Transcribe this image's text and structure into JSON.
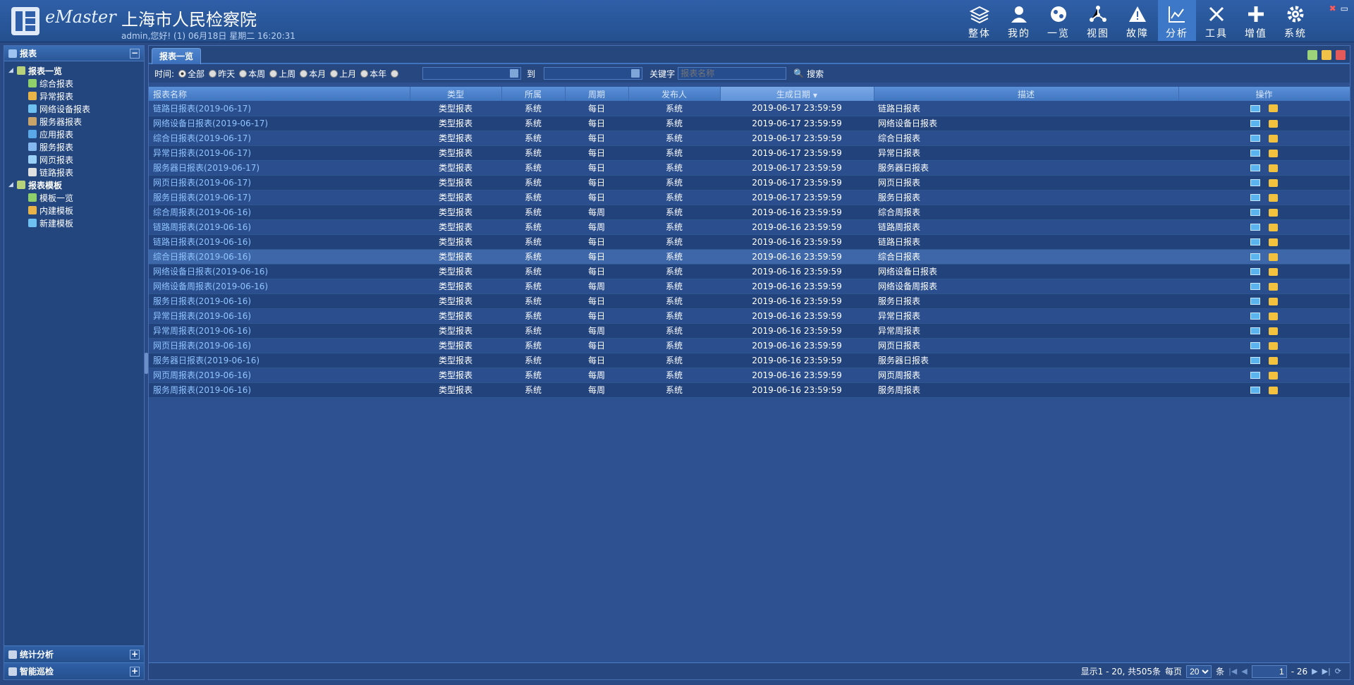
{
  "header": {
    "brand": "eMaster",
    "org": "上海市人民检察院",
    "userline": "admin,您好! (1) 06月18日 星期二 16:20:31",
    "nav": [
      {
        "label": "整体",
        "icon": "layers-icon"
      },
      {
        "label": "我的",
        "icon": "user-icon"
      },
      {
        "label": "一览",
        "icon": "globe-icon"
      },
      {
        "label": "视图",
        "icon": "network-icon"
      },
      {
        "label": "故障",
        "icon": "warning-icon"
      },
      {
        "label": "分析",
        "icon": "chart-icon",
        "active": true
      },
      {
        "label": "工具",
        "icon": "tools-icon"
      },
      {
        "label": "增值",
        "icon": "plus-icon"
      },
      {
        "label": "系统",
        "icon": "gear-icon"
      }
    ]
  },
  "sidebar": {
    "title": "报表",
    "tree": {
      "group1": "报表一览",
      "items1": [
        "综合报表",
        "异常报表",
        "网络设备报表",
        "服务器报表",
        "应用报表",
        "服务报表",
        "网页报表",
        "链路报表"
      ],
      "group2": "报表模板",
      "items2": [
        "模板一览",
        "内建模板",
        "新建模板"
      ]
    },
    "accordion": [
      "统计分析",
      "智能巡检"
    ]
  },
  "tab": {
    "label": "报表一览"
  },
  "filter": {
    "time_label": "时间:",
    "options": [
      "全部",
      "昨天",
      "本周",
      "上周",
      "本月",
      "上月",
      "本年"
    ],
    "selected": "全部",
    "to_label": "到",
    "keyword_label": "关键字",
    "keyword_placeholder": "报表名称",
    "search_label": "搜索"
  },
  "table": {
    "columns": [
      "报表名称",
      "类型",
      "所属",
      "周期",
      "发布人",
      "生成日期",
      "描述",
      "操作"
    ],
    "sorted_column": "生成日期",
    "rows": [
      [
        "链路日报表(2019-06-17)",
        "类型报表",
        "系统",
        "每日",
        "系统",
        "2019-06-17 23:59:59",
        "链路日报表"
      ],
      [
        "网络设备日报表(2019-06-17)",
        "类型报表",
        "系统",
        "每日",
        "系统",
        "2019-06-17 23:59:59",
        "网络设备日报表"
      ],
      [
        "综合日报表(2019-06-17)",
        "类型报表",
        "系统",
        "每日",
        "系统",
        "2019-06-17 23:59:59",
        "综合日报表"
      ],
      [
        "异常日报表(2019-06-17)",
        "类型报表",
        "系统",
        "每日",
        "系统",
        "2019-06-17 23:59:59",
        "异常日报表"
      ],
      [
        "服务器日报表(2019-06-17)",
        "类型报表",
        "系统",
        "每日",
        "系统",
        "2019-06-17 23:59:59",
        "服务器日报表"
      ],
      [
        "网页日报表(2019-06-17)",
        "类型报表",
        "系统",
        "每日",
        "系统",
        "2019-06-17 23:59:59",
        "网页日报表"
      ],
      [
        "服务日报表(2019-06-17)",
        "类型报表",
        "系统",
        "每日",
        "系统",
        "2019-06-17 23:59:59",
        "服务日报表"
      ],
      [
        "综合周报表(2019-06-16)",
        "类型报表",
        "系统",
        "每周",
        "系统",
        "2019-06-16 23:59:59",
        "综合周报表"
      ],
      [
        "链路周报表(2019-06-16)",
        "类型报表",
        "系统",
        "每周",
        "系统",
        "2019-06-16 23:59:59",
        "链路周报表"
      ],
      [
        "链路日报表(2019-06-16)",
        "类型报表",
        "系统",
        "每日",
        "系统",
        "2019-06-16 23:59:59",
        "链路日报表"
      ],
      [
        "综合日报表(2019-06-16)",
        "类型报表",
        "系统",
        "每日",
        "系统",
        "2019-06-16 23:59:59",
        "综合日报表"
      ],
      [
        "网络设备日报表(2019-06-16)",
        "类型报表",
        "系统",
        "每日",
        "系统",
        "2019-06-16 23:59:59",
        "网络设备日报表"
      ],
      [
        "网络设备周报表(2019-06-16)",
        "类型报表",
        "系统",
        "每周",
        "系统",
        "2019-06-16 23:59:59",
        "网络设备周报表"
      ],
      [
        "服务日报表(2019-06-16)",
        "类型报表",
        "系统",
        "每日",
        "系统",
        "2019-06-16 23:59:59",
        "服务日报表"
      ],
      [
        "异常日报表(2019-06-16)",
        "类型报表",
        "系统",
        "每日",
        "系统",
        "2019-06-16 23:59:59",
        "异常日报表"
      ],
      [
        "异常周报表(2019-06-16)",
        "类型报表",
        "系统",
        "每周",
        "系统",
        "2019-06-16 23:59:59",
        "异常周报表"
      ],
      [
        "网页日报表(2019-06-16)",
        "类型报表",
        "系统",
        "每日",
        "系统",
        "2019-06-16 23:59:59",
        "网页日报表"
      ],
      [
        "服务器日报表(2019-06-16)",
        "类型报表",
        "系统",
        "每日",
        "系统",
        "2019-06-16 23:59:59",
        "服务器日报表"
      ],
      [
        "网页周报表(2019-06-16)",
        "类型报表",
        "系统",
        "每周",
        "系统",
        "2019-06-16 23:59:59",
        "网页周报表"
      ],
      [
        "服务周报表(2019-06-16)",
        "类型报表",
        "系统",
        "每周",
        "系统",
        "2019-06-16 23:59:59",
        "服务周报表"
      ]
    ],
    "selected_row": 10
  },
  "pager": {
    "summary": "显示1 - 20, 共505条",
    "per_page_label": "每页",
    "per_page": "20",
    "unit": "条",
    "page": "1",
    "total_pages": "- 26"
  },
  "colors": {
    "link": "#8fc4ff",
    "header_bg": "#2f5fa8",
    "active_nav": "#3d78c8"
  }
}
